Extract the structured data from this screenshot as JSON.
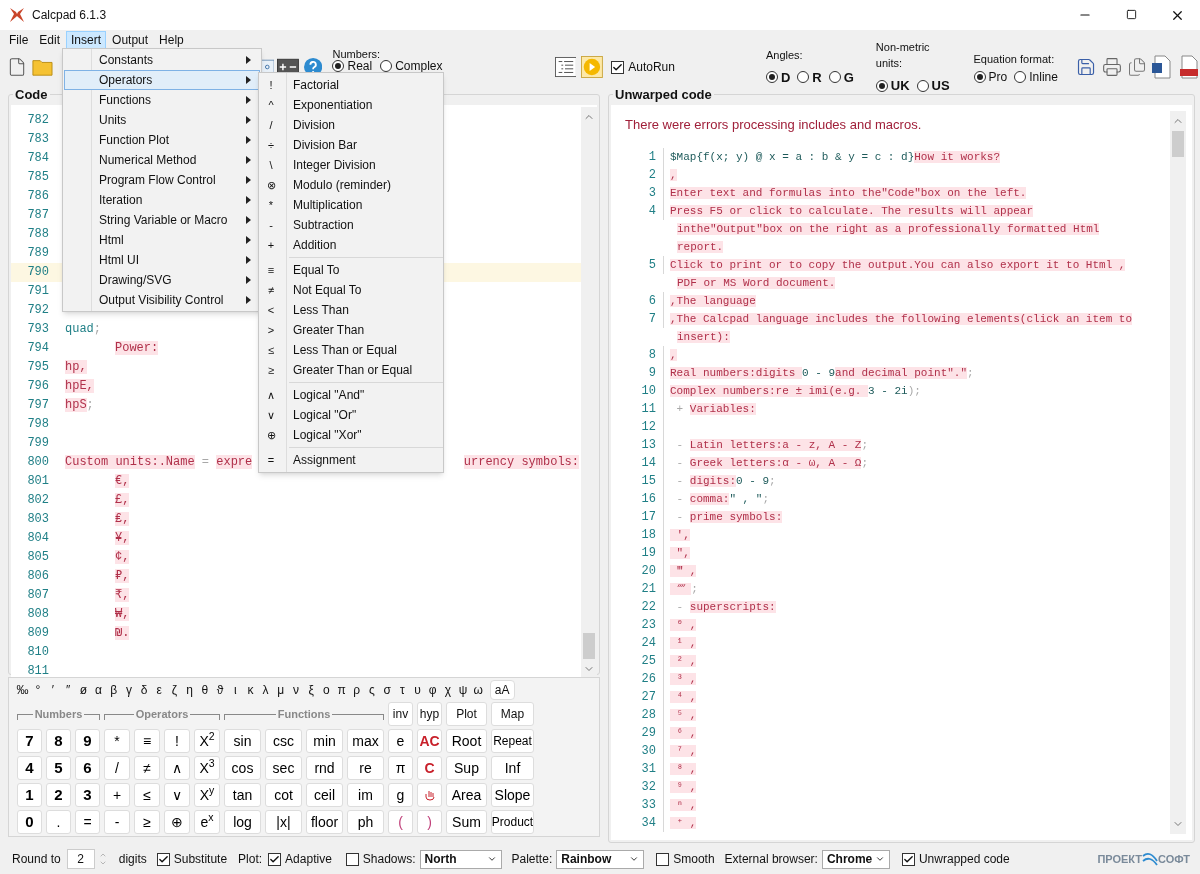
{
  "window": {
    "title": "Calcpad 6.1.3"
  },
  "menu_bar": [
    {
      "label": "File",
      "selected": false
    },
    {
      "label": "Edit",
      "selected": false
    },
    {
      "label": "Insert",
      "selected": true
    },
    {
      "label": "Output",
      "selected": false
    },
    {
      "label": "Help",
      "selected": false
    }
  ],
  "insert_menu": [
    {
      "label": "Constants",
      "selected": false
    },
    {
      "label": "Operators",
      "selected": true
    },
    {
      "label": "Functions",
      "selected": false
    },
    {
      "label": "Units",
      "selected": false
    },
    {
      "label": "Function Plot",
      "selected": false
    },
    {
      "label": "Numerical Method",
      "selected": false
    },
    {
      "label": "Program Flow Control",
      "selected": false
    },
    {
      "label": "Iteration",
      "selected": false
    },
    {
      "label": "String Variable or Macro",
      "selected": false
    },
    {
      "label": "Html",
      "selected": false
    },
    {
      "label": "Html UI",
      "selected": false
    },
    {
      "label": "Drawing/SVG",
      "selected": false
    },
    {
      "label": "Output Visibility Control",
      "selected": false
    }
  ],
  "operators_submenu": [
    [
      {
        "symbol": "!",
        "label": "Factorial"
      },
      {
        "symbol": "^",
        "label": "Exponentiation"
      },
      {
        "symbol": "/",
        "label": "Division"
      },
      {
        "symbol": "÷",
        "label": "Division Bar"
      },
      {
        "symbol": "\\",
        "label": "Integer Division"
      },
      {
        "symbol": "⊗",
        "label": "Modulo (reminder)"
      },
      {
        "symbol": "*",
        "label": "Multiplication"
      },
      {
        "symbol": "-",
        "label": "Subtraction"
      },
      {
        "symbol": "+",
        "label": "Addition"
      }
    ],
    [
      {
        "symbol": "≡",
        "label": "Equal To"
      },
      {
        "symbol": "≠",
        "label": "Not Equal To"
      },
      {
        "symbol": "<",
        "label": "Less Than"
      },
      {
        "symbol": ">",
        "label": "Greater Than"
      },
      {
        "symbol": "≤",
        "label": "Less Than or Equal"
      },
      {
        "symbol": "≥",
        "label": "Greater Than or Equal"
      }
    ],
    [
      {
        "symbol": "∧",
        "label": "Logical \"And\""
      },
      {
        "symbol": "∨",
        "label": "Logical \"Or\""
      },
      {
        "symbol": "⊕",
        "label": "Logical \"Xor\""
      }
    ],
    [
      {
        "symbol": "=",
        "label": "Assignment"
      }
    ]
  ],
  "toolbar": {
    "numbers": {
      "label": "Numbers:",
      "options": [
        {
          "label": "Real",
          "selected": true
        },
        {
          "label": "Complex",
          "selected": false
        }
      ]
    },
    "autorun": {
      "label": "AutoRun",
      "checked": true
    },
    "angles": {
      "label": "Angles:",
      "options": [
        {
          "label": "D",
          "selected": true
        },
        {
          "label": "R",
          "selected": false
        },
        {
          "label": "G",
          "selected": false
        }
      ]
    },
    "units": {
      "label": "Non-metric units:",
      "options": [
        {
          "label": "UK",
          "selected": true
        },
        {
          "label": "US",
          "selected": false
        }
      ]
    },
    "equation_format": {
      "label": "Equation format:",
      "options": [
        {
          "label": "Pro",
          "selected": true
        },
        {
          "label": "Inline",
          "selected": false
        }
      ]
    }
  },
  "code_panel": {
    "title": "Code",
    "lines": [
      {
        "num": "782",
        "current": false
      },
      {
        "num": "783",
        "current": false
      },
      {
        "num": "784",
        "current": false
      },
      {
        "num": "785",
        "current": false
      },
      {
        "num": "786",
        "current": false
      },
      {
        "num": "787",
        "current": false
      },
      {
        "num": "788",
        "current": false
      },
      {
        "num": "789",
        "current": false
      },
      {
        "num": "790",
        "current": true
      },
      {
        "num": "791",
        "current": false
      },
      {
        "num": "792",
        "current": false
      },
      {
        "num": "793",
        "current": false,
        "segments": [
          {
            "text": "quad",
            "kind": "var"
          },
          {
            "text": ";",
            "kind": "op"
          }
        ]
      },
      {
        "num": "794",
        "current": false,
        "indented": true,
        "segments": [
          {
            "text": "Power:",
            "kind": "text"
          }
        ]
      },
      {
        "num": "795",
        "current": false,
        "segments": [
          {
            "text": "hp,",
            "kind": "text"
          }
        ]
      },
      {
        "num": "796",
        "current": false,
        "segments": [
          {
            "text": "hpE,",
            "kind": "text"
          }
        ]
      },
      {
        "num": "797",
        "current": false,
        "segments": [
          {
            "text": "hpS",
            "kind": "text"
          },
          {
            "text": ";",
            "kind": "op"
          }
        ]
      },
      {
        "num": "798",
        "current": false
      },
      {
        "num": "799",
        "current": false
      },
      {
        "num": "800",
        "current": false,
        "segments": [
          {
            "text": "Custom units:",
            "kind": "text"
          },
          {
            "text": ".Name",
            "kind": "text"
          },
          {
            "text": " = ",
            "kind": "op"
          },
          {
            "text": "expre",
            "kind": "text"
          }
        ],
        "right_segments": [
          {
            "text": "urrency symbols:",
            "kind": "text"
          }
        ]
      },
      {
        "num": "801",
        "current": false,
        "indented": true,
        "segments": [
          {
            "text": "€,",
            "kind": "text"
          }
        ]
      },
      {
        "num": "802",
        "current": false,
        "indented": true,
        "segments": [
          {
            "text": "£,",
            "kind": "text"
          }
        ]
      },
      {
        "num": "803",
        "current": false,
        "indented": true,
        "segments": [
          {
            "text": "₤,",
            "kind": "text"
          }
        ]
      },
      {
        "num": "804",
        "current": false,
        "indented": true,
        "segments": [
          {
            "text": "¥,",
            "kind": "text"
          }
        ]
      },
      {
        "num": "805",
        "current": false,
        "indented": true,
        "segments": [
          {
            "text": "¢,",
            "kind": "text"
          }
        ]
      },
      {
        "num": "806",
        "current": false,
        "indented": true,
        "segments": [
          {
            "text": "₽,",
            "kind": "text"
          }
        ]
      },
      {
        "num": "807",
        "current": false,
        "indented": true,
        "segments": [
          {
            "text": "₹,",
            "kind": "text"
          }
        ]
      },
      {
        "num": "808",
        "current": false,
        "indented": true,
        "segments": [
          {
            "text": "₩,",
            "kind": "text"
          }
        ]
      },
      {
        "num": "809",
        "current": false,
        "indented": true,
        "segments": [
          {
            "text": "₪.",
            "kind": "text"
          }
        ]
      },
      {
        "num": "810",
        "current": false
      },
      {
        "num": "811",
        "current": false
      }
    ]
  },
  "keypad": {
    "symbols": [
      "‰",
      "°",
      "′",
      "″",
      "ø",
      "α",
      "β",
      "γ",
      "δ",
      "ε",
      "ζ",
      "η",
      "θ",
      "ϑ",
      "ι",
      "κ",
      "λ",
      "μ",
      "ν",
      "ξ",
      "ο",
      "π",
      "ρ",
      "ς",
      "σ",
      "τ",
      "υ",
      "φ",
      "χ",
      "ψ",
      "ω"
    ],
    "case_key": "aA",
    "groups": [
      "Numbers",
      "Operators",
      "Functions"
    ],
    "top_keys": [
      "inv",
      "hyp",
      "Plot",
      "Map"
    ],
    "rows": [
      [
        {
          "label": "7",
          "kind": "digit"
        },
        {
          "label": "8",
          "kind": "digit"
        },
        {
          "label": "9",
          "kind": "digit"
        },
        {
          "label": "*",
          "kind": "key"
        },
        {
          "label": "≡",
          "kind": "key"
        },
        {
          "label": "!",
          "kind": "key"
        },
        {
          "label": "X$^{2}$",
          "kind": "key"
        },
        {
          "label": "sin",
          "kind": "key"
        },
        {
          "label": "csc",
          "kind": "key"
        },
        {
          "label": "min",
          "kind": "key"
        },
        {
          "label": "max",
          "kind": "key"
        },
        {
          "label": "e",
          "kind": "key"
        },
        {
          "label": "AC",
          "kind": "red"
        },
        {
          "label": "Root",
          "kind": "key"
        },
        {
          "label": "Repeat",
          "kind": "small"
        }
      ],
      [
        {
          "label": "4",
          "kind": "digit"
        },
        {
          "label": "5",
          "kind": "digit"
        },
        {
          "label": "6",
          "kind": "digit"
        },
        {
          "label": "/",
          "kind": "key"
        },
        {
          "label": "≠",
          "kind": "key"
        },
        {
          "label": "∧",
          "kind": "key"
        },
        {
          "label": "X$^{3}$",
          "kind": "key"
        },
        {
          "label": "cos",
          "kind": "key"
        },
        {
          "label": "sec",
          "kind": "key"
        },
        {
          "label": "rnd",
          "kind": "key"
        },
        {
          "label": "re",
          "kind": "key"
        },
        {
          "label": "π",
          "kind": "key"
        },
        {
          "label": "C",
          "kind": "red"
        },
        {
          "label": "Sup",
          "kind": "key"
        },
        {
          "label": "Inf",
          "kind": "key"
        }
      ],
      [
        {
          "label": "1",
          "kind": "digit"
        },
        {
          "label": "2",
          "kind": "digit"
        },
        {
          "label": "3",
          "kind": "digit"
        },
        {
          "label": "+",
          "kind": "key"
        },
        {
          "label": "≤",
          "kind": "key"
        },
        {
          "label": "∨",
          "kind": "key"
        },
        {
          "label": "X$^{y}$",
          "kind": "key"
        },
        {
          "label": "tan",
          "kind": "key"
        },
        {
          "label": "cot",
          "kind": "key"
        },
        {
          "label": "ceil",
          "kind": "key"
        },
        {
          "label": "im",
          "kind": "key"
        },
        {
          "label": "g",
          "kind": "key"
        },
        {
          "kind": "icon"
        },
        {
          "label": "Area",
          "kind": "key"
        },
        {
          "label": "Slope",
          "kind": "key"
        }
      ],
      [
        {
          "label": "0",
          "kind": "digit"
        },
        {
          "label": ".",
          "kind": "key"
        },
        {
          "label": "=",
          "kind": "key"
        },
        {
          "label": "-",
          "kind": "key"
        },
        {
          "label": "≥",
          "kind": "key"
        },
        {
          "label": "⊕",
          "kind": "key"
        },
        {
          "label": "e$^{x}$",
          "kind": "key"
        },
        {
          "label": "log",
          "kind": "key"
        },
        {
          "label": "|x|",
          "kind": "key"
        },
        {
          "label": "floor",
          "kind": "key"
        },
        {
          "label": "ph",
          "kind": "key"
        },
        {
          "label": "(",
          "kind": "paren"
        },
        {
          "label": ")",
          "kind": "paren"
        },
        {
          "label": "Sum",
          "kind": "key"
        },
        {
          "label": "Product",
          "kind": "small"
        }
      ]
    ]
  },
  "output_panel": {
    "title": "Unwarped code",
    "message": "There were errors processing includes and macros.",
    "rows": [
      {
        "num": "1",
        "segments": [
          {
            "text": "$Map{f(x; y) @ x = a : b & y = c : d}",
            "kind": "code"
          },
          {
            "text": "How it works?",
            "kind": "text"
          }
        ]
      },
      {
        "num": "2",
        "segments": [
          {
            "text": ",",
            "kind": "text"
          }
        ]
      },
      {
        "num": "3",
        "segments": [
          {
            "text": "Enter text and formulas into the\"Code\"box on the left.",
            "kind": "text"
          }
        ]
      },
      {
        "num": "4",
        "segments": [
          {
            "text": "Press F5 or click to calculate. The results will appear",
            "kind": "text"
          }
        ]
      },
      {
        "segments": [
          {
            "text": "inthe\"Output\"box on the right as a professionally formatted Html",
            "kind": "text"
          }
        ]
      },
      {
        "segments": [
          {
            "text": "report.",
            "kind": "text"
          }
        ]
      },
      {
        "num": "5",
        "segments": [
          {
            "text": "Click to print or to copy the output.You can also export it to Html ,",
            "kind": "text"
          }
        ]
      },
      {
        "segments": [
          {
            "text": "PDF or MS Word document.",
            "kind": "text"
          }
        ]
      },
      {
        "num": "6",
        "segments": [
          {
            "text": ",The language",
            "kind": "text"
          }
        ]
      },
      {
        "num": "7",
        "segments": [
          {
            "text": ",The Calcpad language includes the following elements(click an item to",
            "kind": "text"
          }
        ]
      },
      {
        "segments": [
          {
            "text": "insert):",
            "kind": "text"
          }
        ]
      },
      {
        "num": "8",
        "segments": [
          {
            "text": ",",
            "kind": "text"
          }
        ]
      },
      {
        "num": "9",
        "segments": [
          {
            "text": "Real numbers:digits ",
            "kind": "text"
          },
          {
            "text": "0 - 9",
            "kind": "code"
          },
          {
            "text": "and decimal point\".\"",
            "kind": "text"
          },
          {
            "text": ";",
            "kind": "op"
          }
        ]
      },
      {
        "num": "10",
        "segments": [
          {
            "text": "Complex numbers:re ± imi(e.g. ",
            "kind": "text"
          },
          {
            "text": "3 - 2i",
            "kind": "code"
          },
          {
            "text": ");",
            "kind": "op"
          }
        ]
      },
      {
        "num": "11",
        "segments": [
          {
            "text": " + ",
            "kind": "op"
          },
          {
            "text": "Variables:",
            "kind": "text"
          }
        ]
      },
      {
        "num": "12"
      },
      {
        "num": "13",
        "segments": [
          {
            "text": " - ",
            "kind": "op"
          },
          {
            "text": "Latin letters:a - z, A - Z",
            "kind": "text"
          },
          {
            "text": ";",
            "kind": "op"
          }
        ]
      },
      {
        "num": "14",
        "segments": [
          {
            "text": " - ",
            "kind": "op"
          },
          {
            "text": "Greek letters:α - ω, Α - Ω",
            "kind": "text"
          },
          {
            "text": ";",
            "kind": "op"
          }
        ]
      },
      {
        "num": "15",
        "segments": [
          {
            "text": " - ",
            "kind": "op"
          },
          {
            "text": "digits:",
            "kind": "text"
          },
          {
            "text": "0 - 9",
            "kind": "code"
          },
          {
            "text": ";",
            "kind": "op"
          }
        ]
      },
      {
        "num": "16",
        "segments": [
          {
            "text": " - ",
            "kind": "op"
          },
          {
            "text": "comma:",
            "kind": "text"
          },
          {
            "text": "\" , \"",
            "kind": "code"
          },
          {
            "text": ";",
            "kind": "op"
          }
        ]
      },
      {
        "num": "17",
        "segments": [
          {
            "text": " - ",
            "kind": "op"
          },
          {
            "text": "prime symbols:",
            "kind": "text"
          }
        ]
      },
      {
        "num": "18",
        "segments": [
          {
            "text": " ′,",
            "kind": "text"
          }
        ]
      },
      {
        "num": "19",
        "segments": [
          {
            "text": " ″,",
            "kind": "text"
          }
        ]
      },
      {
        "num": "20",
        "segments": [
          {
            "text": " ‴ ,",
            "kind": "text"
          }
        ]
      },
      {
        "num": "21",
        "segments": [
          {
            "text": " ⁗ ",
            "kind": "text"
          },
          {
            "text": ";",
            "kind": "op"
          }
        ]
      },
      {
        "num": "22",
        "segments": [
          {
            "text": " - ",
            "kind": "op"
          },
          {
            "text": "superscripts:",
            "kind": "text"
          }
        ]
      },
      {
        "num": "23",
        "segments": [
          {
            "text": " ⁰ ,",
            "kind": "text"
          }
        ]
      },
      {
        "num": "24",
        "segments": [
          {
            "text": " ¹ ,",
            "kind": "text"
          }
        ]
      },
      {
        "num": "25",
        "segments": [
          {
            "text": " ² ,",
            "kind": "text"
          }
        ]
      },
      {
        "num": "26",
        "segments": [
          {
            "text": " ³ ,",
            "kind": "text"
          }
        ]
      },
      {
        "num": "27",
        "segments": [
          {
            "text": " ⁴ ,",
            "kind": "text"
          }
        ]
      },
      {
        "num": "28",
        "segments": [
          {
            "text": " ⁵ ,",
            "kind": "text"
          }
        ]
      },
      {
        "num": "29",
        "segments": [
          {
            "text": " ⁶ ,",
            "kind": "text"
          }
        ]
      },
      {
        "num": "30",
        "segments": [
          {
            "text": " ⁷ ,",
            "kind": "text"
          }
        ]
      },
      {
        "num": "31",
        "segments": [
          {
            "text": " ⁸ ,",
            "kind": "text"
          }
        ]
      },
      {
        "num": "32",
        "segments": [
          {
            "text": " ⁹ ,",
            "kind": "text"
          }
        ]
      },
      {
        "num": "33",
        "segments": [
          {
            "text": " ⁿ ,",
            "kind": "text"
          }
        ]
      },
      {
        "num": "34",
        "segments": [
          {
            "text": " ⁺ ,",
            "kind": "text"
          }
        ]
      }
    ]
  },
  "status_bar": {
    "round_label": "Round to",
    "round_value": "2",
    "digits_label": "digits",
    "substitute": {
      "label": "Substitute",
      "checked": true
    },
    "plot_label": "Plot:",
    "adaptive": {
      "label": "Adaptive",
      "checked": true
    },
    "shadows": {
      "label": "Shadows:",
      "checked": false,
      "value": "North"
    },
    "palette": {
      "label": "Palette:",
      "value": "Rainbow"
    },
    "smooth": {
      "label": "Smooth",
      "checked": false
    },
    "browser": {
      "label": "External browser:",
      "value": "Chrome"
    },
    "unwrapped": {
      "label": "Unwrapped code",
      "checked": true
    },
    "logo": [
      "ПРОЕКТ",
      "СОФТ"
    ]
  }
}
